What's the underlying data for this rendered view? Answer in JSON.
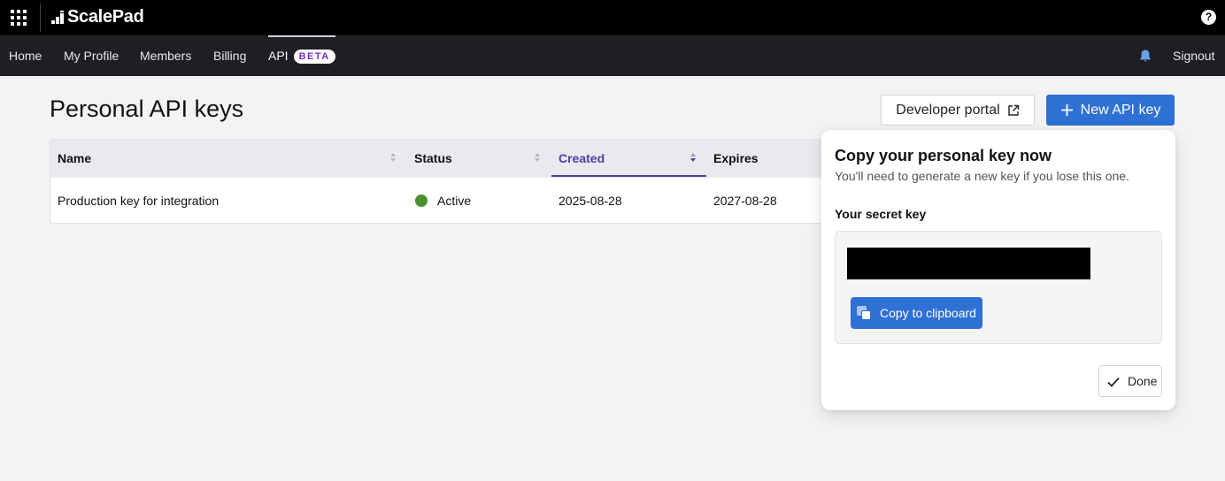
{
  "app": {
    "brand": "ScalePad"
  },
  "icons": {
    "apps": "apps-grid-icon",
    "help": "help-icon",
    "bell": "bell-icon",
    "external": "external-link-icon",
    "plus": "plus-icon",
    "copy": "copy-icon",
    "check": "checkmark-icon"
  },
  "topbar": {
    "help_glyph": "?"
  },
  "nav": {
    "items": [
      {
        "label": "Home"
      },
      {
        "label": "My Profile"
      },
      {
        "label": "Members"
      },
      {
        "label": "Billing"
      },
      {
        "label": "API",
        "badge": "BETA",
        "active": true
      }
    ],
    "signout": "Signout"
  },
  "page": {
    "title": "Personal API keys",
    "developer_portal": "Developer portal",
    "new_api_key": "New API key"
  },
  "table": {
    "columns": [
      {
        "label": "Name",
        "sortable": true
      },
      {
        "label": "Status",
        "sortable": true
      },
      {
        "label": "Created",
        "sortable": true,
        "sorted": "desc"
      },
      {
        "label": "Expires",
        "sortable": false
      }
    ],
    "rows": [
      {
        "name": "Production key for integration",
        "status": "Active",
        "created": "2025-08-28",
        "expires": "2027-08-28"
      }
    ]
  },
  "popover": {
    "title": "Copy your personal key now",
    "subtitle": "You'll need to generate a new key if you lose this one.",
    "secret_label": "Your secret key",
    "copy_button": "Copy to clipboard",
    "done_button": "Done"
  },
  "colors": {
    "accent": "#2f70d4",
    "sorted_column": "#4a3fa8",
    "status_active": "#4a8f2e",
    "beta_badge": "#7b2fbf",
    "topbar": "#000000",
    "navbar": "#1f1f23"
  }
}
